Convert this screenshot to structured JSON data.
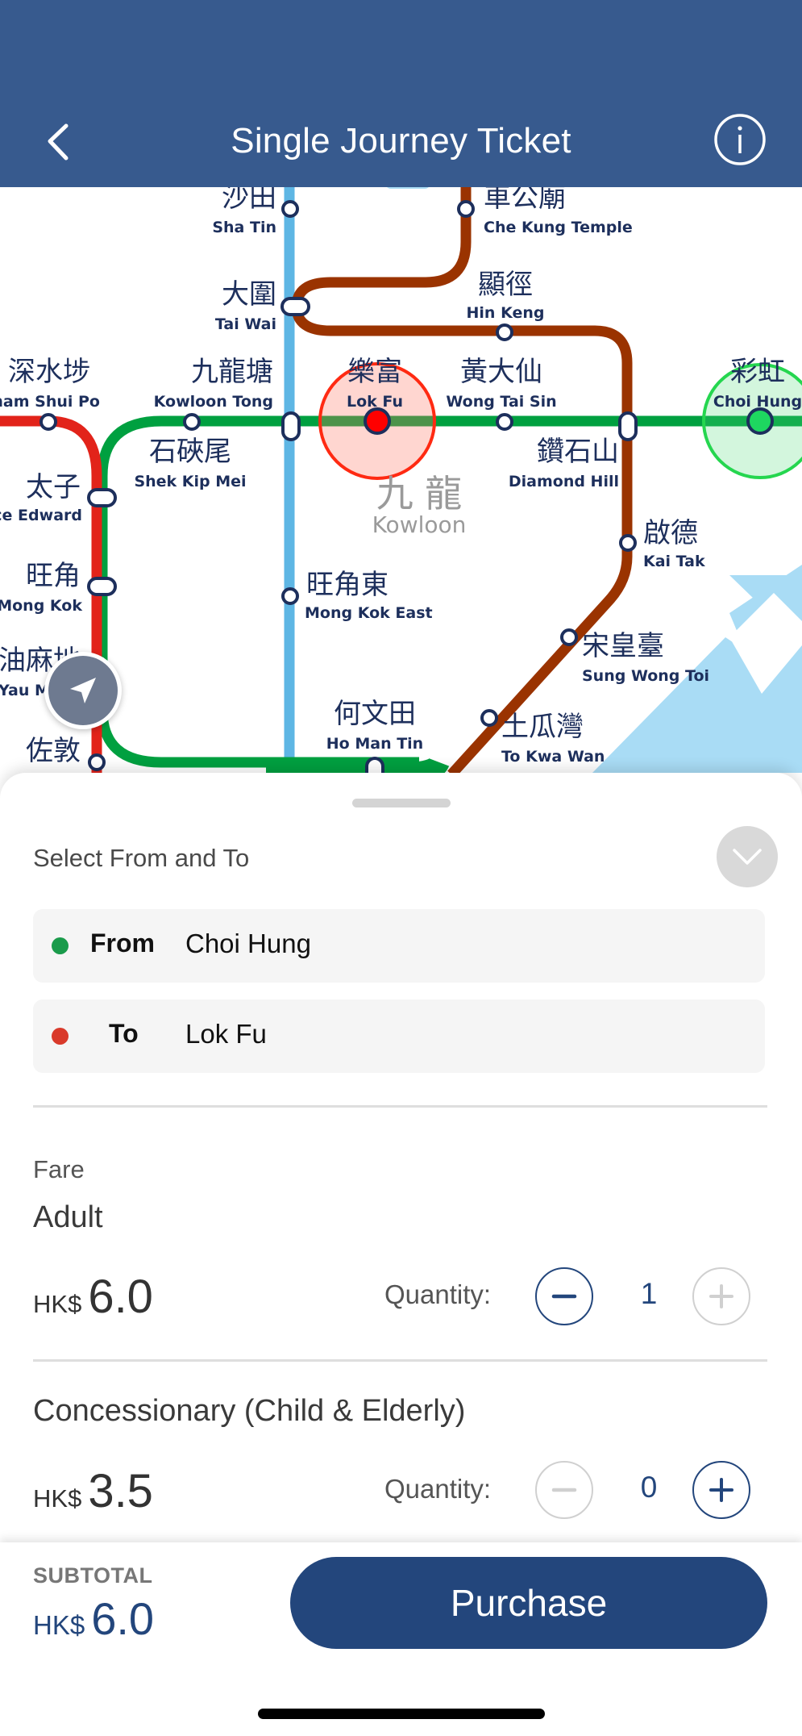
{
  "header": {
    "title": "Single Journey Ticket",
    "back_icon": "chevron-left-icon",
    "info_icon": "info-circle-icon"
  },
  "map": {
    "district": {
      "zh": "九 龍",
      "en": "Kowloon"
    },
    "lines": {
      "tsuen_wan": "#e2231a",
      "kwun_tong": "#00a040",
      "east_rail": "#5eb6e4",
      "tuen_ma": "#9a3300",
      "water": "#a9dcf5"
    },
    "origin_color": "#1ed760",
    "destination_color": "#ff0000",
    "stations": [
      {
        "id": "sha-tin",
        "zh": "沙田",
        "en": "Sha Tin"
      },
      {
        "id": "che-kung-temple",
        "zh": "車公廟",
        "en": "Che Kung Temple"
      },
      {
        "id": "tai-wai",
        "zh": "大圍",
        "en": "Tai Wai"
      },
      {
        "id": "hin-keng",
        "zh": "顯徑",
        "en": "Hin Keng"
      },
      {
        "id": "sham-shui-po",
        "zh": "深水埗",
        "en": "Sham Shui Po"
      },
      {
        "id": "kowloon-tong",
        "zh": "九龍塘",
        "en": "Kowloon Tong"
      },
      {
        "id": "lok-fu",
        "zh": "樂富",
        "en": "Lok Fu"
      },
      {
        "id": "wong-tai-sin",
        "zh": "黃大仙",
        "en": "Wong Tai Sin"
      },
      {
        "id": "choi-hung",
        "zh": "彩虹",
        "en": "Choi Hung"
      },
      {
        "id": "shek-kip-mei",
        "zh": "石硤尾",
        "en": "Shek Kip Mei"
      },
      {
        "id": "diamond-hill",
        "zh": "鑽石山",
        "en": "Diamond Hill"
      },
      {
        "id": "prince-edward",
        "zh": "太子",
        "en": "ce Edward"
      },
      {
        "id": "kai-tak",
        "zh": "啟德",
        "en": "Kai Tak"
      },
      {
        "id": "mong-kok",
        "zh": "旺角",
        "en": "Mong Kok"
      },
      {
        "id": "mong-kok-east",
        "zh": "旺角東",
        "en": "Mong Kok East"
      },
      {
        "id": "sung-wong-toi",
        "zh": "宋皇臺",
        "en": "Sung Wong Toi"
      },
      {
        "id": "yau-ma-tei",
        "zh": "油麻地",
        "en": "Yau M"
      },
      {
        "id": "ho-man-tin",
        "zh": "何文田",
        "en": "Ho Man Tin"
      },
      {
        "id": "to-kwa-wan",
        "zh": "土瓜灣",
        "en": "To Kwa Wan"
      },
      {
        "id": "jordan",
        "zh": "佐敦",
        "en": ""
      }
    ],
    "locate_icon": "location-arrow-icon"
  },
  "selector": {
    "title": "Select From and To",
    "collapse_icon": "chevron-down-icon",
    "from": {
      "label": "From",
      "value": "Choi Hung",
      "dot_color": "#1a9b4b"
    },
    "to": {
      "label": "To",
      "value": "Lok Fu",
      "dot_color": "#d93a2b"
    }
  },
  "fare": {
    "label": "Fare",
    "quantity_label": "Quantity:",
    "categories": [
      {
        "name": "Adult",
        "currency": "HK$",
        "amount": "6.0",
        "quantity": "1",
        "minus_enabled": true,
        "plus_enabled": false
      },
      {
        "name": "Concessionary (Child & Elderly)",
        "currency": "HK$",
        "amount": "3.5",
        "quantity": "0",
        "minus_enabled": false,
        "plus_enabled": true
      }
    ]
  },
  "footer": {
    "subtotal_label": "SUBTOTAL",
    "currency": "HK$",
    "subtotal": "6.0",
    "purchase_label": "Purchase"
  },
  "colors": {
    "header_bg": "#375a8e",
    "primary": "#23467c"
  }
}
